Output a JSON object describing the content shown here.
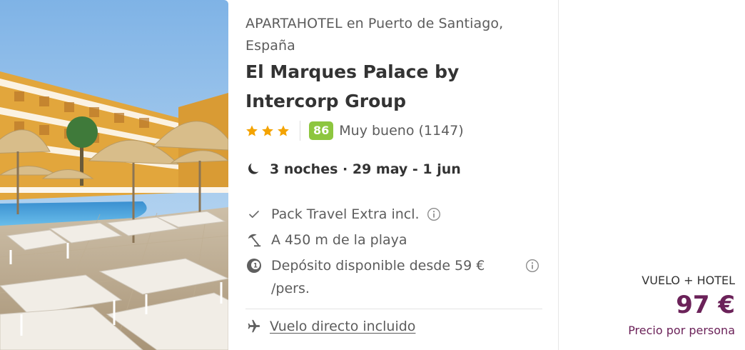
{
  "hotel": {
    "location": "APARTAHOTEL en Puerto de Santiago, España",
    "name": "El Marques Palace by Intercorp Group",
    "stars": 3,
    "score": "86",
    "score_label": "Muy bueno (1147)",
    "dates": "3 noches · 29 may - 1 jun",
    "image_alt": "hotel-pool-photo"
  },
  "features": [
    {
      "icon": "check-icon",
      "text": "Pack Travel Extra incl.",
      "has_info": true
    },
    {
      "icon": "beach-umbrella-icon",
      "text": "A 450 m de la playa",
      "has_info": false
    },
    {
      "icon": "deposit-coin-icon",
      "text": "Depósito disponible desde 59 € /pers.",
      "has_info": true
    }
  ],
  "flight": {
    "icon": "airplane-icon",
    "text": "Vuelo directo incluido"
  },
  "price": {
    "type": "VUELO + HOTEL",
    "amount": "97 €",
    "note": "Precio por persona"
  },
  "colors": {
    "score_bg": "#8dc63f",
    "star": "#f4a300",
    "price": "#6b2259"
  }
}
